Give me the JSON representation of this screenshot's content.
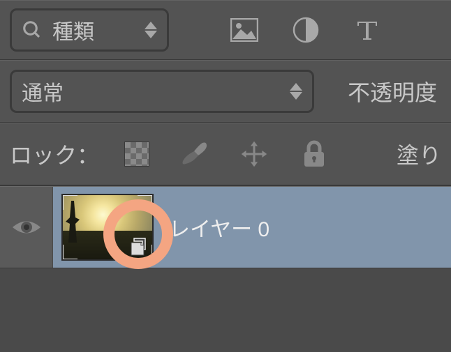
{
  "filter": {
    "kind_label": "種類",
    "icons": [
      "image-icon",
      "adjustment-icon",
      "type-icon"
    ]
  },
  "blend": {
    "mode": "通常",
    "opacity_label": "不透明度"
  },
  "lock": {
    "label": "ロック：",
    "fill_label": "塗り"
  },
  "layers": [
    {
      "name": "レイヤー 0",
      "visible": true,
      "selected": true,
      "smart_object": true
    }
  ]
}
